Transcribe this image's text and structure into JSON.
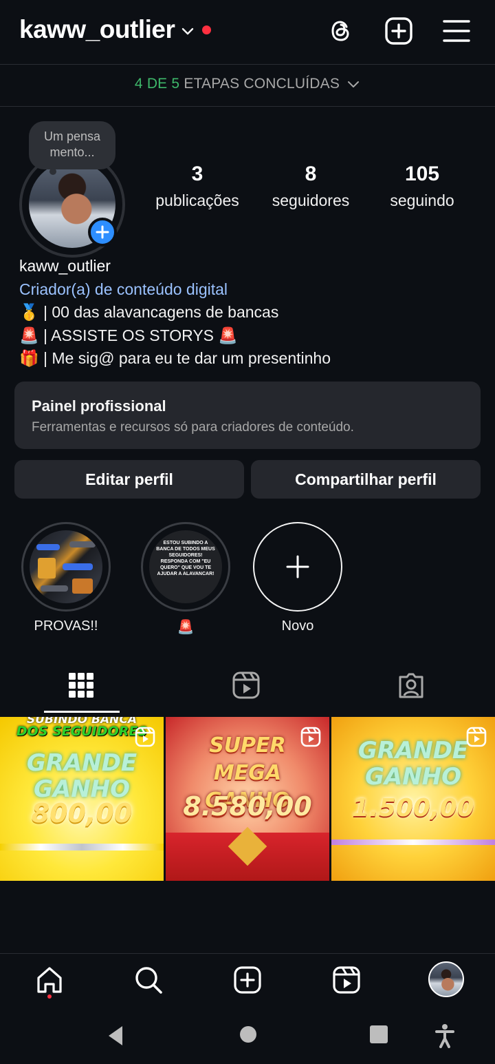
{
  "header": {
    "username": "kaww_outlier",
    "icons": [
      "chevron-down-icon",
      "threads-icon",
      "new-post-icon",
      "menu-icon"
    ],
    "notification_color": "#ff3040"
  },
  "steps_banner": {
    "done": "4 DE 5",
    "text": "ETAPAS CONCLUÍDAS"
  },
  "profile": {
    "thought_bubble": "Um pensa mento...",
    "stats": [
      {
        "value": "3",
        "label": "publicações"
      },
      {
        "value": "8",
        "label": "seguidores"
      },
      {
        "value": "105",
        "label": "seguindo"
      }
    ],
    "name": "kaww_outlier",
    "category": "Criador(a) de conteúdo digital",
    "bio": [
      {
        "emoji": "🥇",
        "text": " | 00 das alavancagens de bancas"
      },
      {
        "emoji": "🚨",
        "text": " | ASSISTE OS STORYS ",
        "emoji_after": "🚨"
      },
      {
        "emoji": "🎁",
        "text": " | Me sig@ para eu te dar um presentinho"
      }
    ]
  },
  "professional_panel": {
    "title": "Painel profissional",
    "subtitle": "Ferramentas e recursos só para criadores de conteúdo."
  },
  "actions": {
    "edit": "Editar perfil",
    "share": "Compartilhar perfil"
  },
  "highlights": [
    {
      "label": "PROVAS!!"
    },
    {
      "label": "🚨",
      "cover_text": "ESTOU SUBINDO A BANCA DE TODOS MEUS SEGUIDORES! RESPONDA COM \"EU QUERO\" QUE VOU TE AJUDAR A ALAVANCAR!"
    },
    {
      "label": "Novo"
    }
  ],
  "tabs": [
    "grid-icon",
    "reels-icon",
    "tagged-icon"
  ],
  "posts": [
    {
      "top": "SUBINDO BANCA",
      "sub": "DOS SEGUIDORES",
      "headline": "GRANDE GANHO",
      "amount": "800,00"
    },
    {
      "headline": "SUPER MEGA GANHO",
      "amount": "8.580,00"
    },
    {
      "headline": "GRANDE GANHO",
      "amount": "1.500,00"
    }
  ],
  "bottom_nav": [
    "home-icon",
    "search-icon",
    "create-icon",
    "reels-icon",
    "profile-avatar"
  ],
  "system_nav": [
    "back-icon",
    "home-circle-icon",
    "recents-icon",
    "accessibility-icon"
  ]
}
